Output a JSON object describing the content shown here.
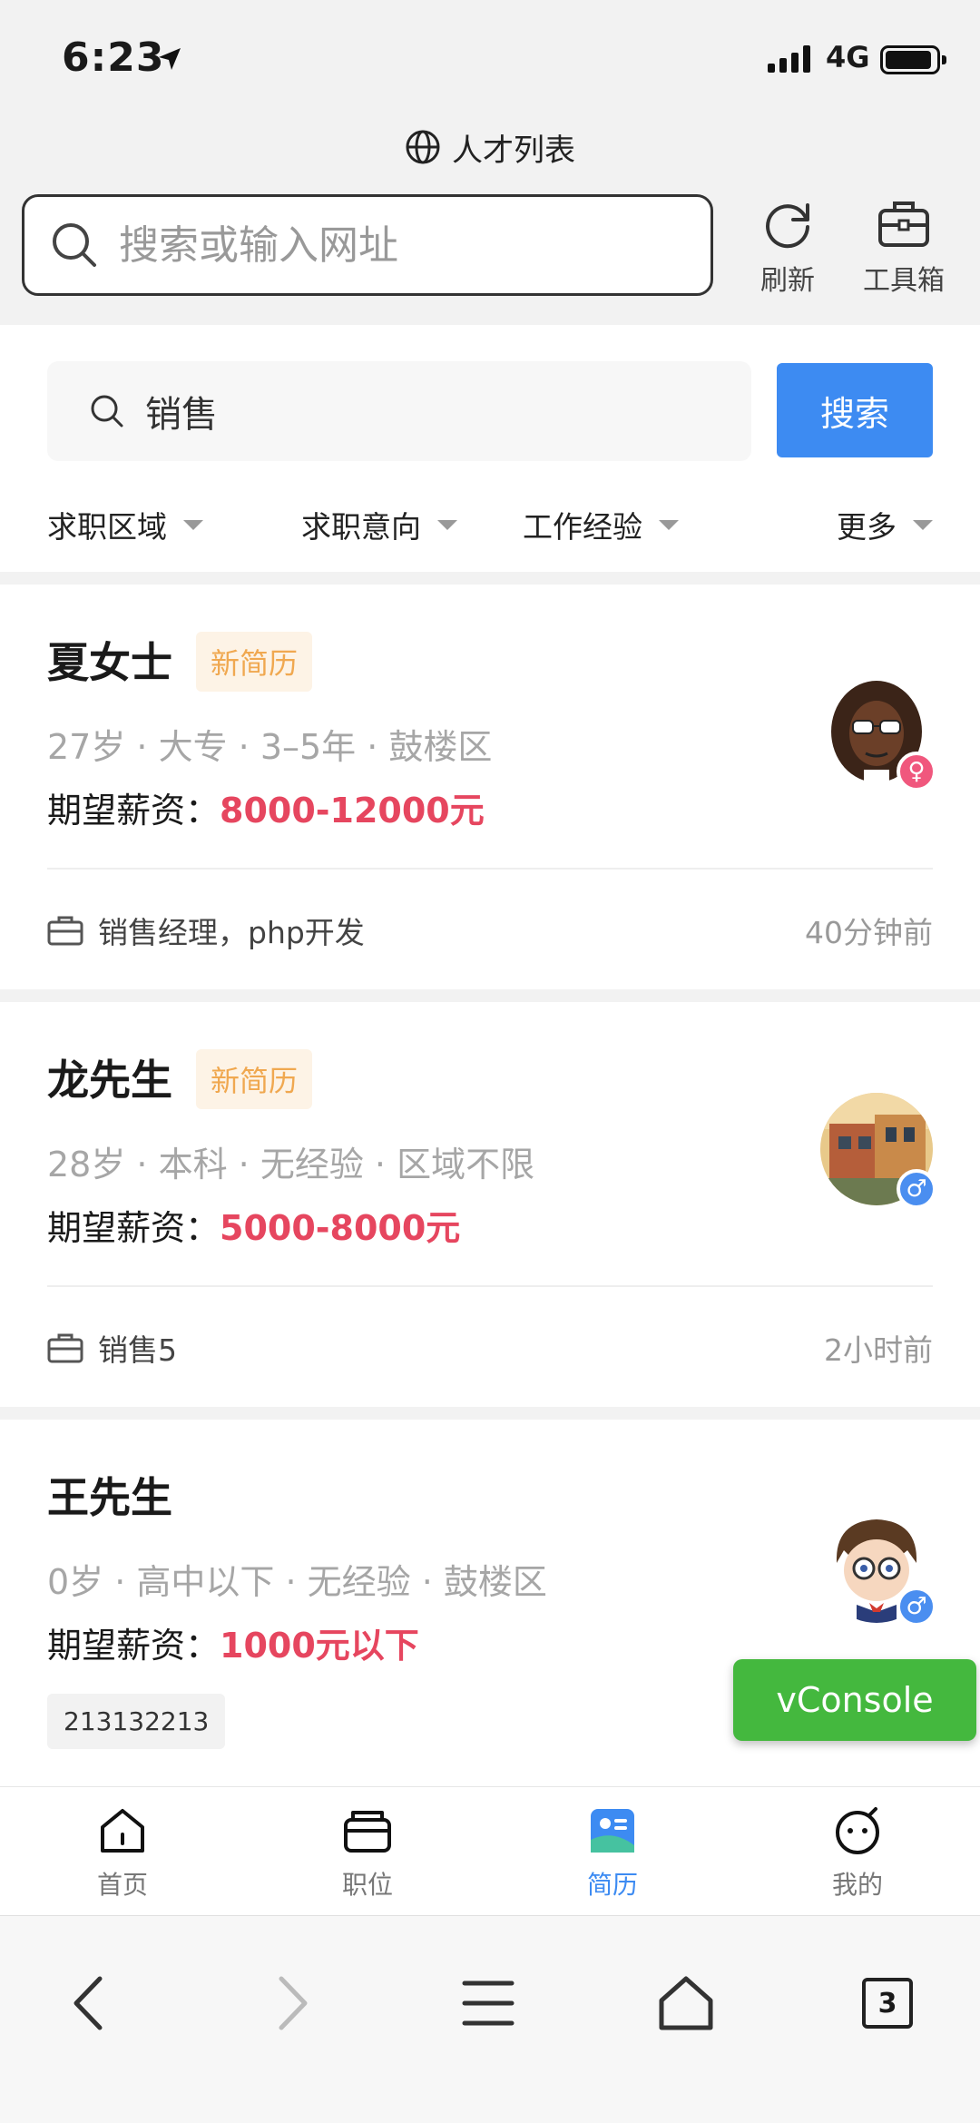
{
  "status_bar": {
    "time": "6:23",
    "network": "4G"
  },
  "browser": {
    "page_title": "人才列表",
    "url_placeholder": "搜索或输入网址",
    "refresh_label": "刷新",
    "toolbox_label": "工具箱",
    "tab_count": "3"
  },
  "search": {
    "query": "销售",
    "button_label": "搜索"
  },
  "filters": [
    "求职区域",
    "求职意向",
    "工作经验",
    "更多"
  ],
  "salary_label": "期望薪资：",
  "resumes": [
    {
      "name": "夏女士",
      "badge": "新简历",
      "meta": "27岁 · 大专 · 3–5年 · 鼓楼区",
      "salary": "8000-12000元",
      "gender_symbol": "♀",
      "intent": "销售经理，php开发",
      "time": "40分钟前"
    },
    {
      "name": "龙先生",
      "badge": "新简历",
      "meta": "28岁 · 本科 · 无经验 · 区域不限",
      "salary": "5000-8000元",
      "gender_symbol": "♂",
      "intent": "销售5",
      "time": "2小时前"
    },
    {
      "name": "王先生",
      "meta": "0岁 · 高中以下 · 无经验 · 鼓楼区",
      "salary": "1000元以下",
      "gender_symbol": "♂",
      "tag": "213132213"
    }
  ],
  "vconsole_label": "vConsole",
  "tabbar": {
    "items": [
      {
        "label": "首页",
        "icon": "home-icon"
      },
      {
        "label": "职位",
        "icon": "briefcase-icon"
      },
      {
        "label": "简历",
        "icon": "resume-icon"
      },
      {
        "label": "我的",
        "icon": "profile-icon"
      }
    ],
    "active": "简历"
  },
  "colors": {
    "accent": "#3d8bf2",
    "salary": "#e6465f",
    "badge_text": "#f0a850",
    "vconsole": "#44b83e"
  }
}
